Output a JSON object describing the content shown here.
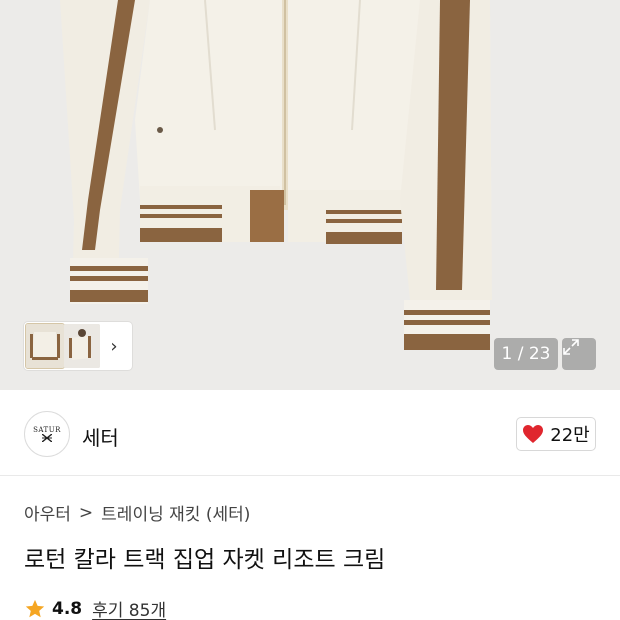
{
  "gallery": {
    "counter": "1 / 23",
    "thumb_more_icon": "chevron-right-icon",
    "expand_icon": "expand-icon"
  },
  "brand": {
    "logo_text_top": "SATUR",
    "name": "세터",
    "like_count": "22만",
    "like_icon": "heart-icon",
    "like_color": "#e0262e"
  },
  "breadcrumb": {
    "category": "아우터",
    "separator": ">",
    "subcategory": "트레이닝 재킷 (세터)"
  },
  "product": {
    "title": "로턴 칼라 트랙 집업 자켓 리조트 크림"
  },
  "rating": {
    "icon": "star-icon",
    "star_color": "#f5a623",
    "value": "4.8",
    "reviews": "후기 85개"
  }
}
